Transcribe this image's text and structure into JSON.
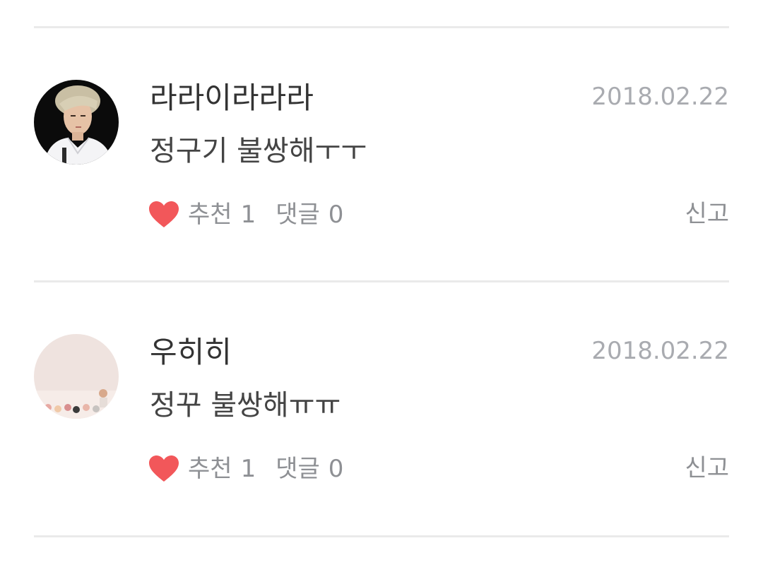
{
  "comments": [
    {
      "username": "라라이라라라",
      "date": "2018.02.22",
      "text": "정구기 불쌍해ㅜㅜ",
      "like_label": "추천",
      "like_count": "1",
      "reply_label": "댓글",
      "reply_count": "0",
      "report_label": "신고",
      "avatar_icon": "profile-photo",
      "heart_icon": "heart-icon"
    },
    {
      "username": "우히히",
      "date": "2018.02.22",
      "text": "정꾸 불쌍해ㅠㅠ",
      "like_label": "추천",
      "like_count": "1",
      "reply_label": "댓글",
      "reply_count": "0",
      "report_label": "신고",
      "avatar_icon": "profile-photo",
      "heart_icon": "heart-icon"
    }
  ],
  "colors": {
    "heart": "#f2575a",
    "divider": "#eaeaea",
    "muted_text": "#8e9094",
    "date_text": "#a9abb0",
    "primary_text": "#333333"
  }
}
